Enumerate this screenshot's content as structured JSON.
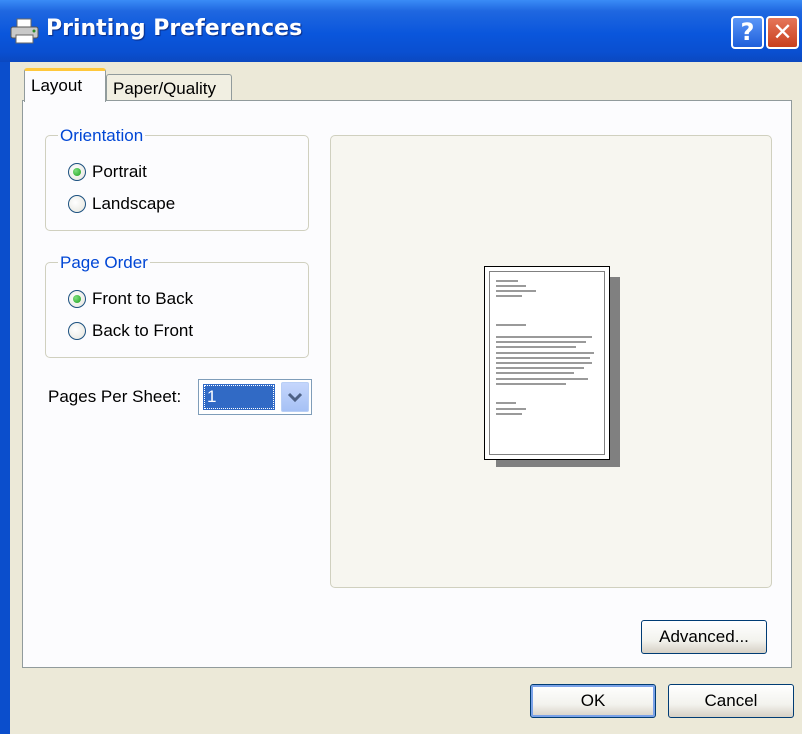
{
  "window": {
    "title": "Printing Preferences",
    "help_label": "?",
    "close_label": "✕"
  },
  "tabs": [
    {
      "label": "Layout",
      "selected": true
    },
    {
      "label": "Paper/Quality",
      "selected": false
    }
  ],
  "orientation": {
    "legend": "Orientation",
    "options": [
      {
        "label": "Portrait",
        "checked": true
      },
      {
        "label": "Landscape",
        "checked": false
      }
    ]
  },
  "page_order": {
    "legend": "Page Order",
    "options": [
      {
        "label": "Front to Back",
        "checked": true
      },
      {
        "label": "Back to Front",
        "checked": false
      }
    ]
  },
  "pages_per_sheet": {
    "label": "Pages Per Sheet:",
    "value": "1"
  },
  "buttons": {
    "advanced": "Advanced...",
    "ok": "OK",
    "cancel": "Cancel"
  },
  "colors": {
    "title_bar": "#0a56dc",
    "legend_text": "#0046d5",
    "selection": "#316ac5"
  },
  "icons": {
    "title": "printer-icon",
    "combo_arrow": "chevron-down-icon"
  }
}
